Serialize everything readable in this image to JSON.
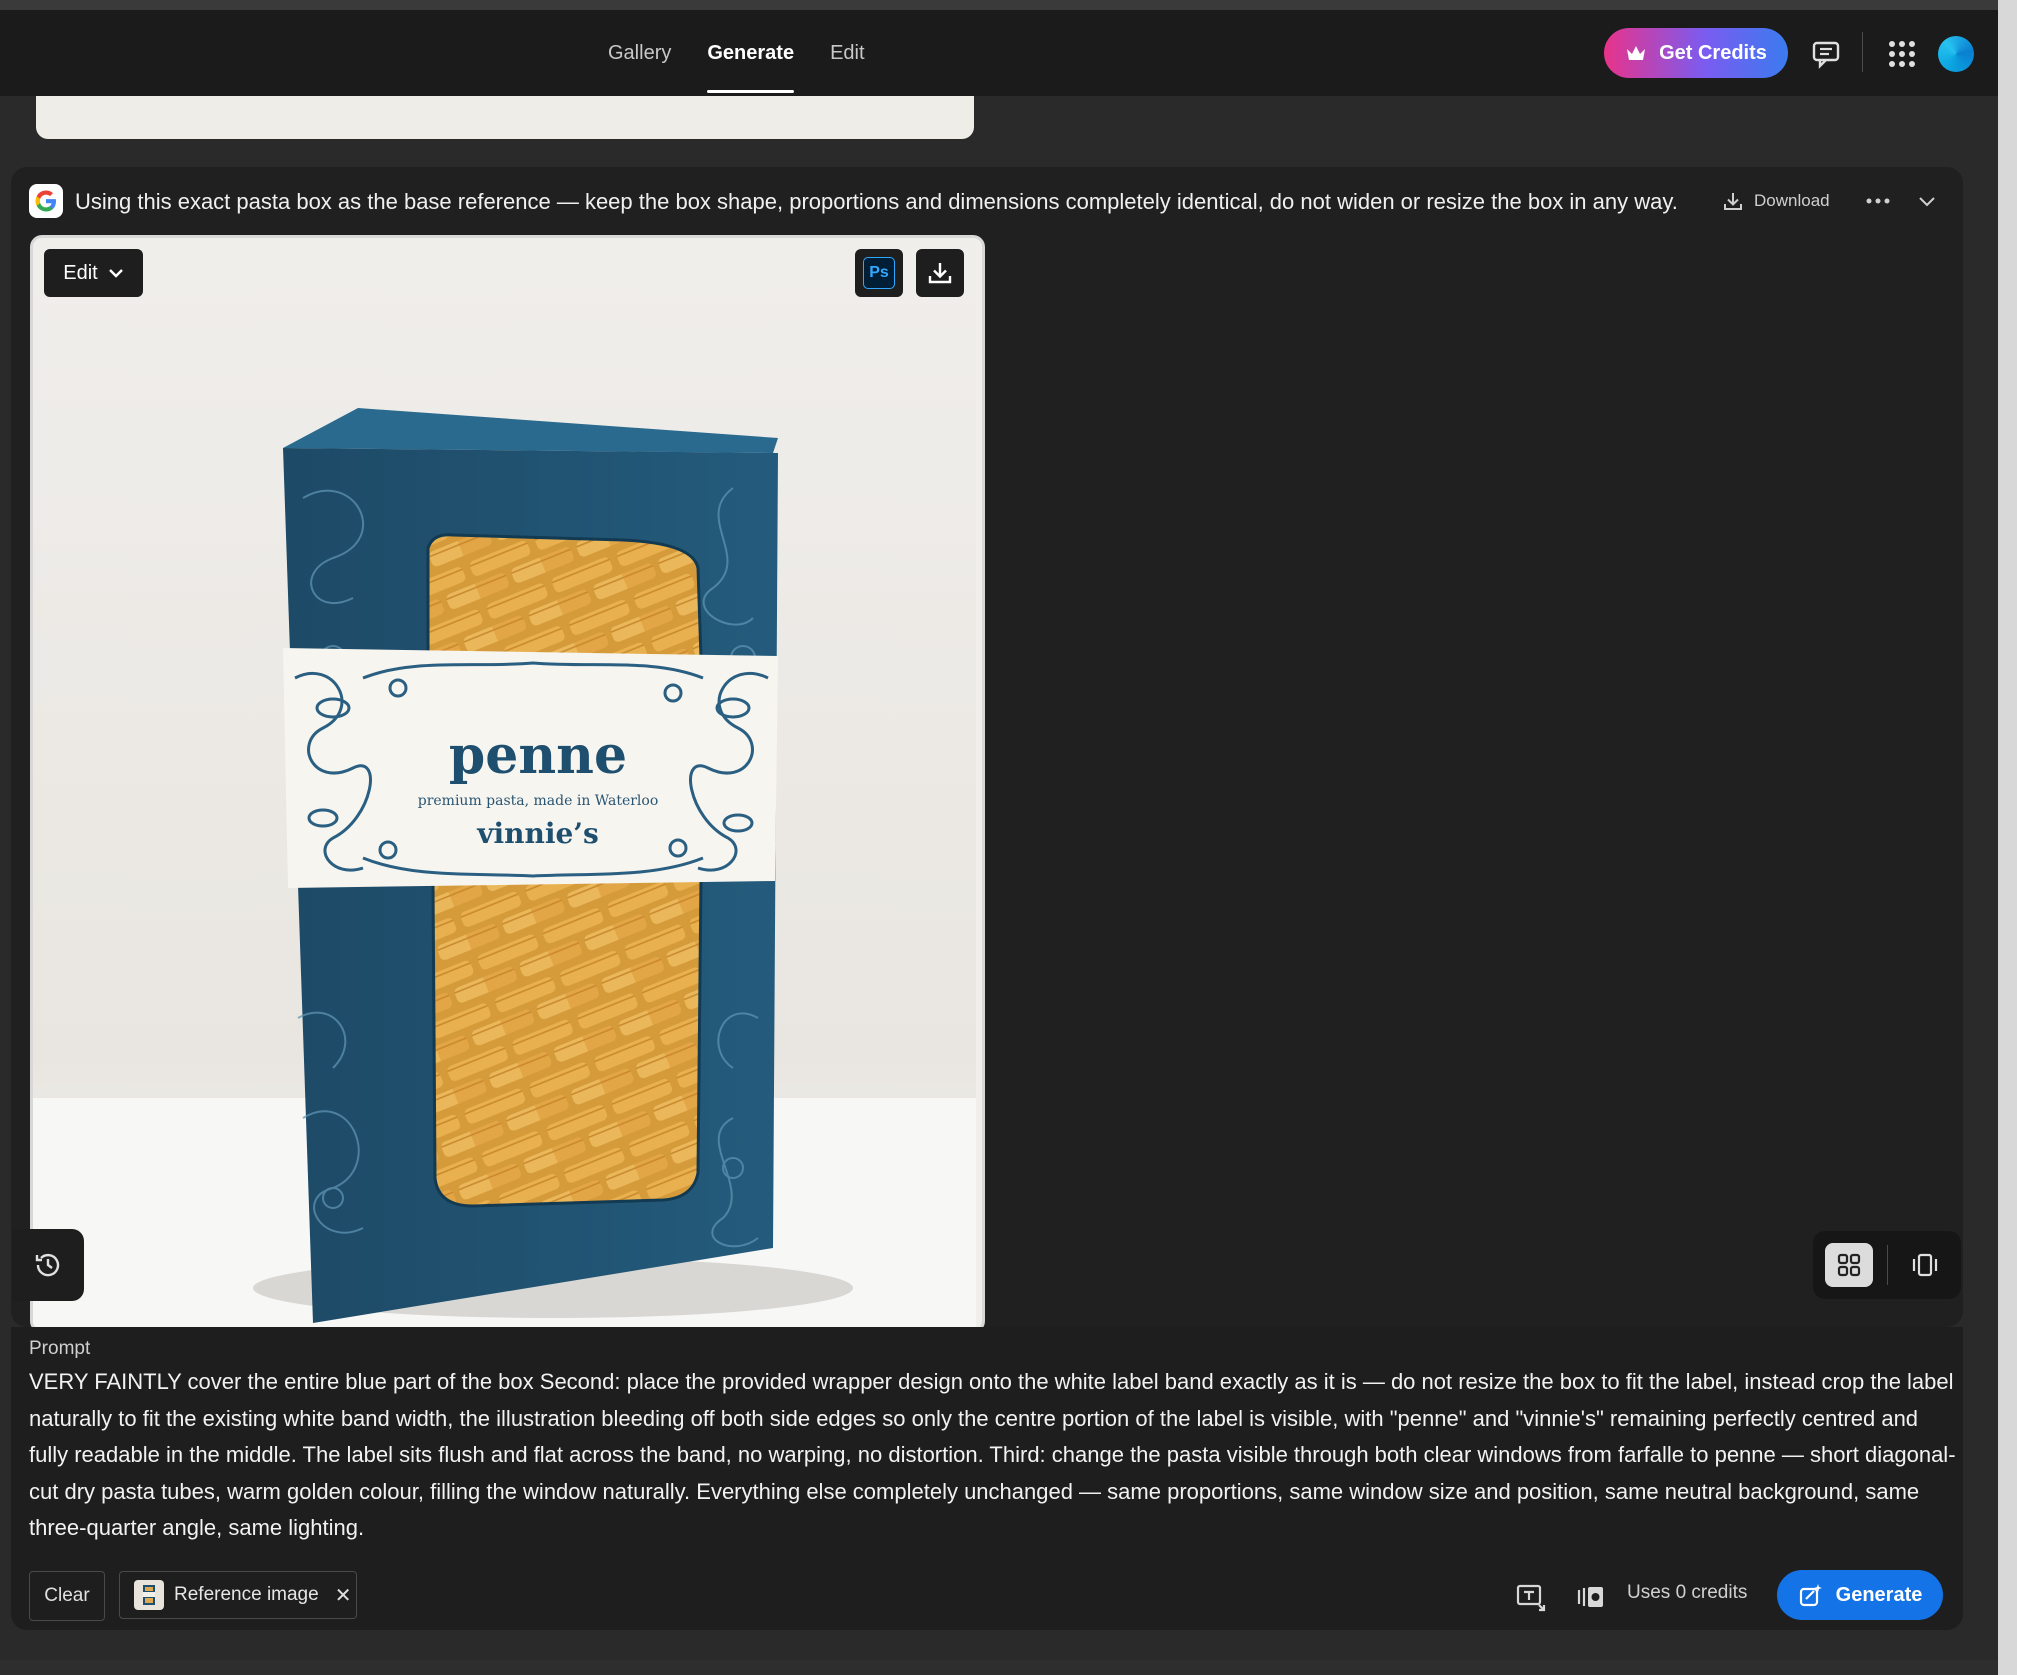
{
  "nav": {
    "tabs": [
      {
        "label": "Gallery"
      },
      {
        "label": "Generate"
      },
      {
        "label": "Edit"
      }
    ],
    "get_credits_label": "Get Credits"
  },
  "result": {
    "prompt_preview": "Using this exact pasta box as the base reference — keep the box shape, proportions and dimensions completely identical, do not widen or resize the box in any way.",
    "download_label": "Download",
    "edit_label": "Edit",
    "ps_label": "Ps",
    "image": {
      "product_name": "penne",
      "tagline": "premium pasta, made in Waterloo",
      "brand": "vinnie’s"
    }
  },
  "prompt_panel": {
    "label": "Prompt",
    "text": "VERY FAINTLY cover the entire blue part of the box Second: place the provided wrapper design onto the white label band exactly as it is — do not resize the box to fit the label, instead crop the label naturally to fit the existing white band width, the illustration bleeding off both side edges so only the centre portion of the label is visible, with \"penne\" and \"vinnie's\" remaining perfectly centred and fully readable in the middle. The label sits flush and flat across the band, no warping, no distortion. Third: change the pasta visible through both clear windows from farfalle to penne — short diagonal-cut dry pasta tubes, warm golden colour, filling the window naturally. Everything else completely unchanged — same proportions, same window size and position, same neutral background, same three-quarter angle, same lighting.",
    "clear_label": "Clear",
    "reference_chip_label": "Reference image",
    "credits_text": "Uses 0 credits",
    "generate_label": "Generate"
  },
  "colors": {
    "accent": "#1473e6",
    "box_blue": "#1f4f6e",
    "background": "#2a2a2a"
  }
}
